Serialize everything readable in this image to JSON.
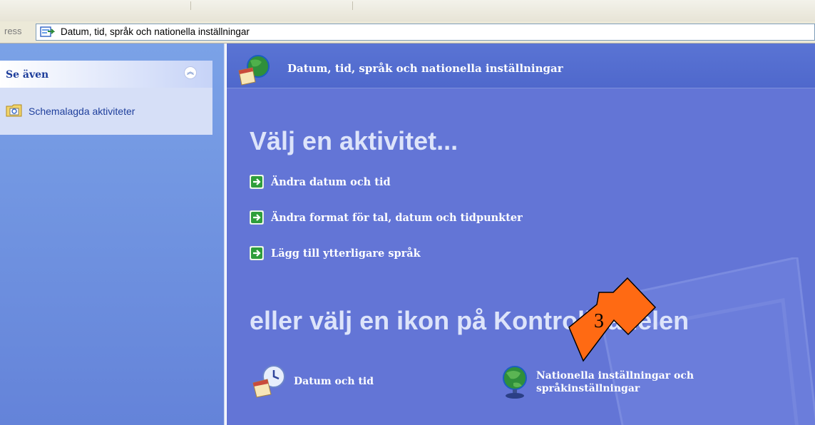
{
  "address_bar": {
    "label": "ress",
    "value": "Datum, tid, språk och nationella inställningar"
  },
  "see_also": {
    "title": "Se även",
    "items": [
      {
        "label": "Schemalagda aktiviteter",
        "icon": "scheduled-tasks-folder-icon"
      }
    ]
  },
  "main": {
    "header_title": "Datum, tid, språk och nationella inställningar",
    "heading_tasks": "Välj en aktivitet...",
    "tasks": [
      {
        "label": "Ändra datum och tid"
      },
      {
        "label": "Ändra format för tal, datum och tidpunkter"
      },
      {
        "label": "Lägg till ytterligare språk"
      }
    ],
    "heading_icons": "eller välj en ikon på Kontrollpanelen",
    "icons": [
      {
        "label_line1": "Datum och tid",
        "label_line2": "",
        "icon": "date-time-icon"
      },
      {
        "label_line1": "Nationella inställningar och",
        "label_line2": "språkinställningar",
        "icon": "globe-icon"
      }
    ]
  },
  "callout": {
    "number": "3",
    "color": "#ff6a13"
  },
  "colors": {
    "main_bg": "#6375d6",
    "left_pane": "#7ba2e7",
    "see_also_title": "#1c3c9a",
    "task_arrow_green": "#2e9e3a"
  }
}
